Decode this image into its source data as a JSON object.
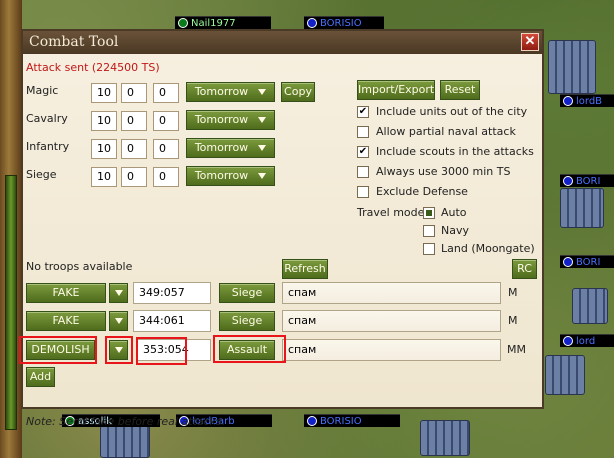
{
  "dialog": {
    "title": "Combat Tool",
    "close_icon": "close-icon",
    "status": "Attack sent (224500 TS)"
  },
  "troops": [
    {
      "label": "Magic",
      "v1": "10",
      "v2": "0",
      "v3": "0",
      "day": "Tomorrow"
    },
    {
      "label": "Cavalry",
      "v1": "10",
      "v2": "0",
      "v3": "0",
      "day": "Tomorrow"
    },
    {
      "label": "Infantry",
      "v1": "10",
      "v2": "0",
      "v3": "0",
      "day": "Tomorrow"
    },
    {
      "label": "Siege",
      "v1": "10",
      "v2": "0",
      "v3": "0",
      "day": "Tomorrow"
    }
  ],
  "copy_label": "Copy",
  "import_export_label": "Import/Export",
  "reset_label": "Reset",
  "options": [
    {
      "label": "Include units out of the city",
      "checked": true
    },
    {
      "label": "Allow partial naval attack",
      "checked": false
    },
    {
      "label": "Include scouts in the attacks",
      "checked": true
    },
    {
      "label": "Always use 3000 min TS",
      "checked": false
    },
    {
      "label": "Exclude Defense",
      "checked": false
    }
  ],
  "travel_mode": {
    "label": "Travel mode",
    "options": [
      {
        "label": "Auto",
        "selected": true
      },
      {
        "label": "Navy",
        "selected": false
      },
      {
        "label": "Land (Moongate)",
        "selected": false
      }
    ]
  },
  "no_troops_text": "No troops available",
  "refresh_label": "Refresh",
  "rc_label": "RC",
  "attacks": [
    {
      "type": "FAKE",
      "coords": "349:057",
      "action": "Siege",
      "note": "спам",
      "suffix": "M"
    },
    {
      "type": "FAKE",
      "coords": "344:061",
      "action": "Siege",
      "note": "спам",
      "suffix": "M"
    },
    {
      "type": "DEMOLISH",
      "coords": "353:054",
      "action": "Assault",
      "note": "спам",
      "suffix": "MM"
    }
  ],
  "add_label": "Add",
  "footer_note": "Note: Send fake before real attacks.",
  "map_players": [
    {
      "name": "Nail1977",
      "color": "green"
    },
    {
      "name": "BORISIO",
      "color": "blue"
    },
    {
      "name": "lordB",
      "color": "blue"
    },
    {
      "name": "BORI",
      "color": "blue"
    },
    {
      "name": "BORI",
      "color": "blue"
    },
    {
      "name": "lord",
      "color": "blue"
    },
    {
      "name": "assolik",
      "color": "green"
    },
    {
      "name": "lordBarb",
      "color": "blue"
    },
    {
      "name": "BORISIO",
      "color": "blue"
    }
  ],
  "colors": {
    "accent_green": "#5e7c2a",
    "highlight_red": "#e8151a",
    "status_red": "#c01818",
    "title_brown": "#4a3824"
  }
}
